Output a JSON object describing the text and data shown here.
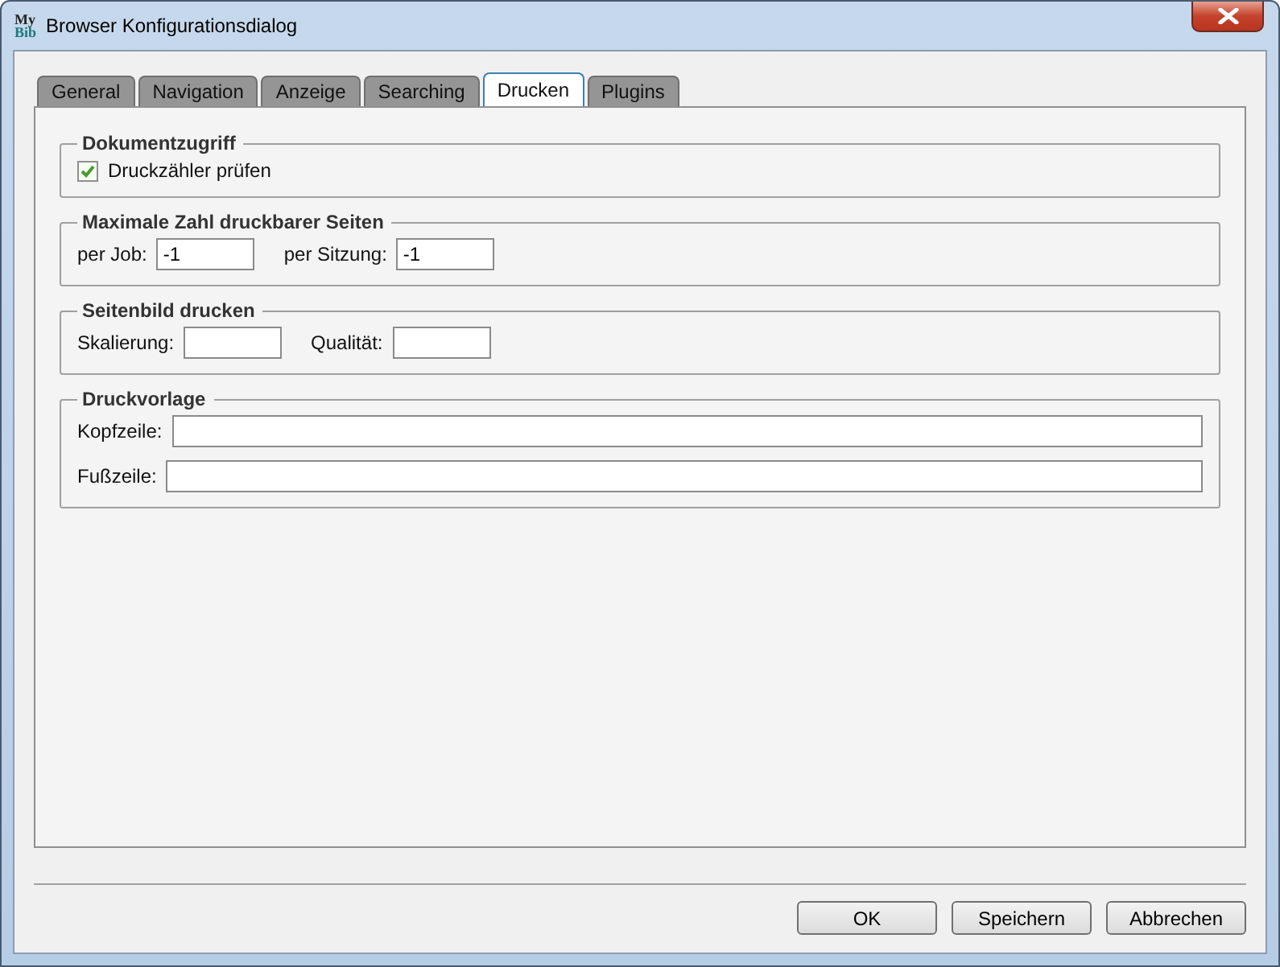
{
  "window": {
    "title": "Browser Konfigurationsdialog",
    "logo_top": "My",
    "logo_bottom": "Bib"
  },
  "tabs": [
    {
      "label": "General",
      "selected": false
    },
    {
      "label": "Navigation",
      "selected": false
    },
    {
      "label": "Anzeige",
      "selected": false
    },
    {
      "label": "Searching",
      "selected": false
    },
    {
      "label": "Drucken",
      "selected": true
    },
    {
      "label": "Plugins",
      "selected": false
    }
  ],
  "groups": [
    {
      "title": "Dokumentzugriff",
      "rows": [
        {
          "kind": "checkbox",
          "label": "Druckzähler prüfen",
          "checked": true
        }
      ]
    },
    {
      "title": "Maximale Zahl druckbarer Seiten",
      "rows": [
        {
          "kind": "fields",
          "fields": [
            {
              "label": "per Job:",
              "value": "-1"
            },
            {
              "label": "per Sitzung:",
              "value": "-1"
            }
          ]
        }
      ]
    },
    {
      "title": "Seitenbild drucken",
      "rows": [
        {
          "kind": "fields",
          "fields": [
            {
              "label": "Skalierung:"
            },
            {
              "label": "Qualität:"
            }
          ]
        }
      ]
    },
    {
      "title": "Druckvorlage",
      "rows": [
        {
          "kind": "wide",
          "label": "Kopfzeile:"
        },
        {
          "kind": "wide",
          "label": "Fußzeile:"
        }
      ]
    }
  ],
  "buttons": [
    "OK",
    "Speichern",
    "Abbrechen"
  ]
}
